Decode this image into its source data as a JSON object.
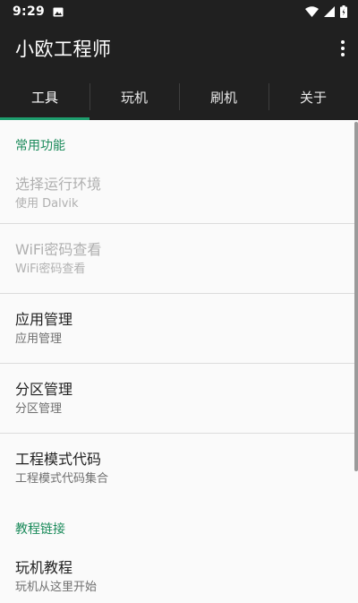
{
  "status_bar": {
    "time": "9:29",
    "icons": [
      "photo-notification-icon",
      "wifi-icon",
      "signal-icon",
      "battery-icon"
    ]
  },
  "app_bar": {
    "title": "小欧工程师",
    "overflow_icon": "more-vert-icon"
  },
  "tabs": [
    {
      "label": "工具",
      "active": true
    },
    {
      "label": "玩机",
      "active": false
    },
    {
      "label": "刷机",
      "active": false
    },
    {
      "label": "关于",
      "active": false
    }
  ],
  "sections": [
    {
      "header": "常用功能",
      "items": [
        {
          "title": "选择运行环境",
          "summary": "使用 Dalvik",
          "enabled": false
        },
        {
          "title": "WiFi密码查看",
          "summary": "WiFi密码查看",
          "enabled": false
        },
        {
          "title": "应用管理",
          "summary": "应用管理",
          "enabled": true
        },
        {
          "title": "分区管理",
          "summary": "分区管理",
          "enabled": true
        },
        {
          "title": "工程模式代码",
          "summary": "工程模式代码集合",
          "enabled": true
        }
      ]
    },
    {
      "header": "教程链接",
      "items": [
        {
          "title": "玩机教程",
          "summary": "玩机从这里开始",
          "enabled": true
        }
      ]
    }
  ],
  "colors": {
    "app_bar": "#202020",
    "accent": "#1e9e6e",
    "section_header": "#1a8a5a",
    "background": "#fafafa"
  }
}
